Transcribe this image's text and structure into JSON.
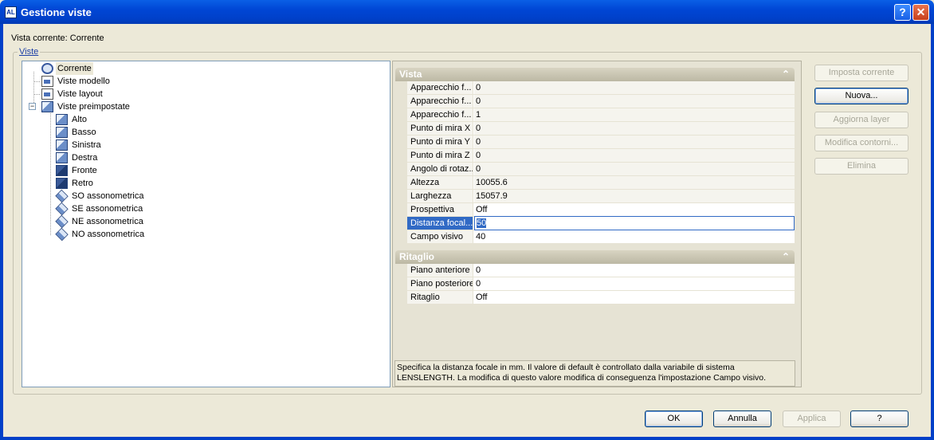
{
  "window": {
    "title": "Gestione viste",
    "help_btn": "?",
    "close_btn": "✕",
    "icon_text": "AL"
  },
  "current_view_label": "Vista corrente: Corrente",
  "views_group_label": "Viste",
  "tree": {
    "items": [
      {
        "label": "Corrente"
      },
      {
        "label": "Viste modello"
      },
      {
        "label": "Viste layout"
      },
      {
        "label": "Viste preimpostate"
      },
      {
        "label": "Alto"
      },
      {
        "label": "Basso"
      },
      {
        "label": "Sinistra"
      },
      {
        "label": "Destra"
      },
      {
        "label": "Fronte"
      },
      {
        "label": "Retro"
      },
      {
        "label": "SO assonometrica"
      },
      {
        "label": "SE assonometrica"
      },
      {
        "label": "NE assonometrica"
      },
      {
        "label": "NO assonometrica"
      }
    ],
    "expander": "−"
  },
  "properties": {
    "section_vista": "Vista",
    "section_ritaglio": "Ritaglio",
    "chevron": "⌃",
    "vista_rows": [
      {
        "name": "Apparecchio f...",
        "value": "0"
      },
      {
        "name": "Apparecchio f...",
        "value": "0"
      },
      {
        "name": "Apparecchio f...",
        "value": "1"
      },
      {
        "name": "Punto di mira X",
        "value": "0"
      },
      {
        "name": "Punto di mira Y",
        "value": "0"
      },
      {
        "name": "Punto di mira Z",
        "value": "0"
      },
      {
        "name": "Angolo di rotaz...",
        "value": "0"
      },
      {
        "name": "Altezza",
        "value": "10055.6"
      },
      {
        "name": "Larghezza",
        "value": "15057.9"
      },
      {
        "name": "Prospettiva",
        "value": "Off"
      },
      {
        "name": "Distanza focal...",
        "value": "50"
      },
      {
        "name": "Campo visivo",
        "value": "40"
      }
    ],
    "ritaglio_rows": [
      {
        "name": "Piano anteriore",
        "value": "0"
      },
      {
        "name": "Piano posteriore",
        "value": "0"
      },
      {
        "name": "Ritaglio",
        "value": "Off"
      }
    ],
    "description_line1": "Specifica la distanza focale in mm. Il valore di default è controllato dalla variabile di sistema",
    "description_line2": "LENSLENGTH. La modifica di questo valore modifica di conseguenza l'impostazione Campo visivo."
  },
  "side_buttons": {
    "set_current": "Imposta corrente",
    "new": "Nuova...",
    "update_layers": "Aggiorna layer",
    "edit_boundaries": "Modifica contorni...",
    "delete": "Elimina"
  },
  "footer_buttons": {
    "ok": "OK",
    "cancel": "Annulla",
    "apply": "Applica",
    "help": "?"
  }
}
